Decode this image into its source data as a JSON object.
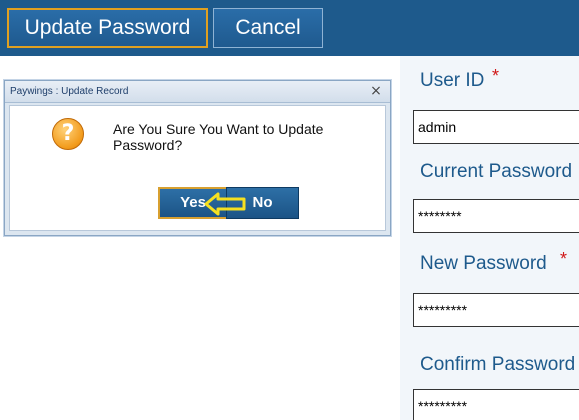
{
  "toolbar": {
    "update_label": "Update Password",
    "cancel_label": "Cancel"
  },
  "form": {
    "user_id": {
      "label": "User ID",
      "required": "*",
      "value": "admin"
    },
    "current_password": {
      "label": "Current Password",
      "value": "********"
    },
    "new_password": {
      "label": "New Password",
      "required": "*",
      "value": "*********"
    },
    "confirm_password": {
      "label": "Confirm Password",
      "value": "*********"
    }
  },
  "dialog": {
    "title": "Paywings : Update Record",
    "close_glyph": "×",
    "icon_glyph": "?",
    "message": "Are You Sure You Want to Update Password?",
    "yes_label": "Yes",
    "no_label": "No"
  },
  "colors": {
    "toolbar_bg": "#1e5a8c",
    "label_blue": "#1e5a8c",
    "required_red": "#d01818",
    "highlight_yellow": "#f5e020"
  },
  "icons": {
    "question": "question-icon",
    "close": "close-icon",
    "pointer": "arrow-pointer-icon"
  }
}
